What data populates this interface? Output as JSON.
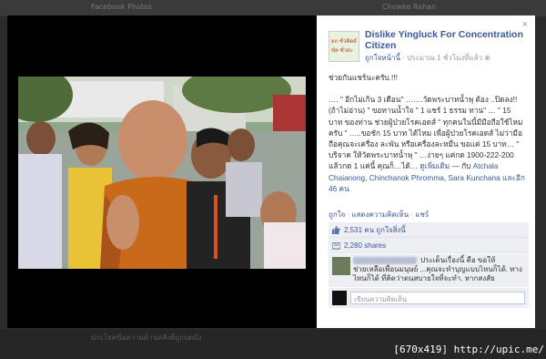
{
  "background": {
    "top_ghost_left": "Facebook Photos",
    "top_ghost_right": "Chowke Rahan",
    "bottom_ghost": "ประโยคข้อความด้านหลังที่ถูกบดบัง"
  },
  "panel": {
    "close_label": "×",
    "page_name": "Dislike Yingluck For Concentration Citizen",
    "avatar_text": [
      "ยก ชั่วคิดส์",
      "ขัด ชั่วสะ"
    ],
    "meta_link": "ถูกใจหน้านี้",
    "meta_time": " · ประมาณ 1 ชั่วโมงที่แล้ว ",
    "body_headline": "ช่วยกันแชร์นะครับ.!!!",
    "body_main": "…. \" อีกไม่เกิน 3 เดือน\" …….วัดพระบาทน้ำพุ ต้อง ..ปิดลง!!(ถ้าไม่อ่าน) \" ขอทานน้ำใจ \" 1 แชร์ 1 ธรรม ทาน\" … \" 15 บาท ของท่าน ช่วยผู้ป่วยโรคเอดส์ \" ทุกคนในนี้มีมือถือใช้ไหมครับ \" …..ขอชัก 15 บาท ได้ไหม เพื่อผู้ป่วยโรคเอดส์ ไม่ว่ามือถือคุณจะเครื่อง ละพัน หรือเครื่องละหมื่น ขอแค่ 15 บาท… \" บริจาค ให้วัดพระบาทน้ำพุ \" …ง่ายๆ แค่กด 1900-222-200 แล้วกด 1 แค่นี้ คุณก็…ได้… ",
    "see_more": "ดูเพิ่มเติม",
    "with_prefix": " — กับ ",
    "tag1": "Atchala Chaianong",
    "comma": ", ",
    "tag2": "Chinchanok Phromma",
    "tag3": "Sara Kunchana",
    "and_more": " และอีก 46 คน",
    "actions": {
      "like": "ถูกใจ",
      "sep1": " · ",
      "comment": "แสดงความคิดเห็น",
      "sep2": " · ",
      "share": "แชร์"
    },
    "stats": {
      "likes": "2,531 คน ถูกใจสิ่งนี้",
      "shares": "2,280 shares"
    },
    "comment": {
      "text_first": "ประเด็นเรื่องนี้ คือ ขอให้",
      "text_rest": "ช่วยเหลือเพื่อนมนุษย์ ...คุณจะทำบุญแบบไหนก็ได้. ทางไหนก็ได้ ที่คิดว่าตนสบายใจที่จะทำ. หากสงสัย"
    },
    "write_placeholder": "เขียนความคิดเห็น"
  },
  "watermark": "[670x419] http://upic.me/",
  "colors": {
    "link": "#3b5998",
    "theater": "#000000",
    "robe": "#c96a1b"
  }
}
